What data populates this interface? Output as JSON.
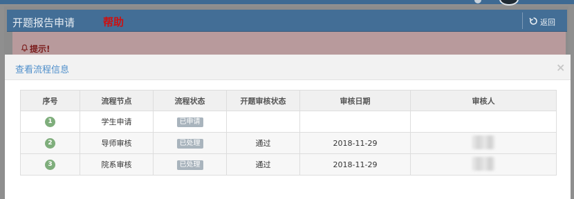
{
  "background": {
    "page_title": "开题报告申请",
    "help_link": "帮助",
    "back_button": "返回",
    "alert_text": "提示!"
  },
  "modal": {
    "title": "查看流程信息",
    "close_symbol": "×",
    "columns": [
      "序号",
      "流程节点",
      "流程状态",
      "开题审核状态",
      "审核日期",
      "审核人"
    ],
    "rows": [
      {
        "index": "1",
        "node": "学生申请",
        "status": "已申请",
        "review_status": "",
        "review_date": "",
        "reviewer": ""
      },
      {
        "index": "2",
        "node": "导师审核",
        "status": "已处理",
        "review_status": "通过",
        "review_date": "2018-11-29",
        "reviewer": ""
      },
      {
        "index": "3",
        "node": "院系审核",
        "status": "已处理",
        "review_status": "通过",
        "review_date": "2018-11-29",
        "reviewer": ""
      }
    ]
  },
  "colors": {
    "header_blue": "#436e96",
    "modal_title": "#4f8fcb",
    "badge_green": "#7fae7c",
    "status_gray": "#a9b4bd",
    "help_red": "#cc1111"
  },
  "icons": [
    "bell-icon",
    "refresh-back-icon",
    "close-icon"
  ]
}
